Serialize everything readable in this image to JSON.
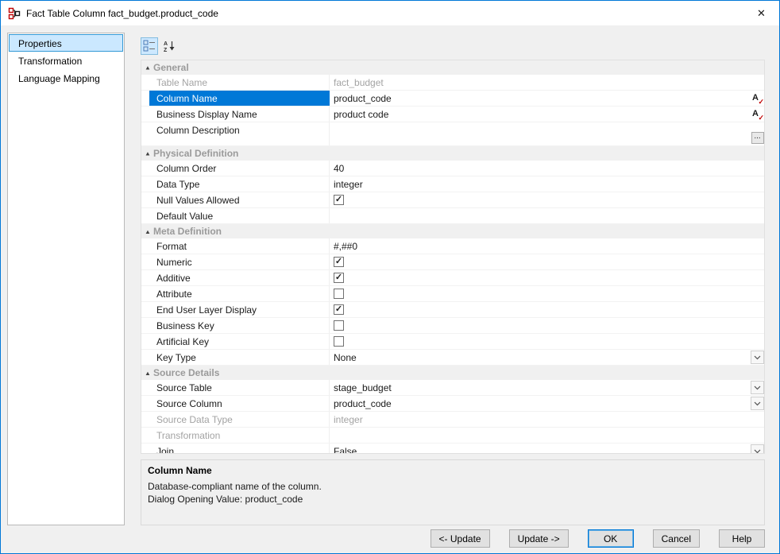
{
  "window": {
    "title": "Fact Table Column fact_budget.product_code"
  },
  "glyphs": {
    "close": "✕",
    "collapse": "▲",
    "check": "✓",
    "ellipsis": "...",
    "rename_letter": "A",
    "rename_mark": "✓"
  },
  "sidebar": {
    "items": [
      {
        "label": "Properties",
        "selected": true
      },
      {
        "label": "Transformation",
        "selected": false
      },
      {
        "label": "Language Mapping",
        "selected": false
      }
    ]
  },
  "toolbar": {
    "buttons": [
      {
        "name": "categorized-view",
        "active": true
      },
      {
        "name": "alphabetical-sort",
        "active": false
      }
    ]
  },
  "property_grid": {
    "categories": [
      {
        "name": "General",
        "rows": [
          {
            "label": "Table Name",
            "value": "fact_budget",
            "disabled": true
          },
          {
            "label": "Column Name",
            "value": "product_code",
            "selected": true,
            "trailing": "rename"
          },
          {
            "label": "Business Display Name",
            "value": "product code",
            "trailing": "rename"
          },
          {
            "label": "Column Description",
            "value": "",
            "tall": true,
            "trailing": "ellipsis"
          }
        ]
      },
      {
        "name": "Physical Definition",
        "rows": [
          {
            "label": "Column Order",
            "value": "40"
          },
          {
            "label": "Data Type",
            "value": "integer"
          },
          {
            "label": "Null Values Allowed",
            "control": "checkbox",
            "checked": true
          },
          {
            "label": "Default Value",
            "value": ""
          }
        ]
      },
      {
        "name": "Meta Definition",
        "rows": [
          {
            "label": "Format",
            "value": "#,##0"
          },
          {
            "label": "Numeric",
            "control": "checkbox",
            "checked": true
          },
          {
            "label": "Additive",
            "control": "checkbox",
            "checked": true
          },
          {
            "label": "Attribute",
            "control": "checkbox",
            "checked": false
          },
          {
            "label": "End User Layer Display",
            "control": "checkbox",
            "checked": true
          },
          {
            "label": "Business Key",
            "control": "checkbox",
            "checked": false
          },
          {
            "label": "Artificial Key",
            "control": "checkbox",
            "checked": false
          },
          {
            "label": "Key Type",
            "value": "None",
            "trailing": "dropdown"
          }
        ]
      },
      {
        "name": "Source Details",
        "rows": [
          {
            "label": "Source Table",
            "value": "stage_budget",
            "trailing": "dropdown"
          },
          {
            "label": "Source Column",
            "value": "product_code",
            "trailing": "dropdown"
          },
          {
            "label": "Source Data Type",
            "value": "integer",
            "disabled": true
          },
          {
            "label": "Transformation",
            "value": "",
            "disabled": true
          },
          {
            "label": "Join",
            "value": "False",
            "trailing": "dropdown"
          }
        ]
      }
    ]
  },
  "description": {
    "title": "Column Name",
    "line1": "Database-compliant name of the column.",
    "line2": "Dialog Opening Value: product_code"
  },
  "footer": {
    "buttons": [
      {
        "label": "<- Update",
        "name": "update-back-button",
        "default": false
      },
      {
        "label": "Update ->",
        "name": "update-forward-button",
        "default": false
      },
      {
        "label": "OK",
        "name": "ok-button",
        "default": true
      },
      {
        "label": "Cancel",
        "name": "cancel-button",
        "default": false
      },
      {
        "label": "Help",
        "name": "help-button",
        "default": false
      }
    ]
  },
  "colors": {
    "accent": "#0078d7",
    "selection_bg": "#0078d7",
    "sidebar_selected_bg": "#cbe8ff",
    "category_text": "#9a9a9a",
    "disabled_text": "#a3a3a3",
    "rename_icon_accent": "#c00000"
  }
}
